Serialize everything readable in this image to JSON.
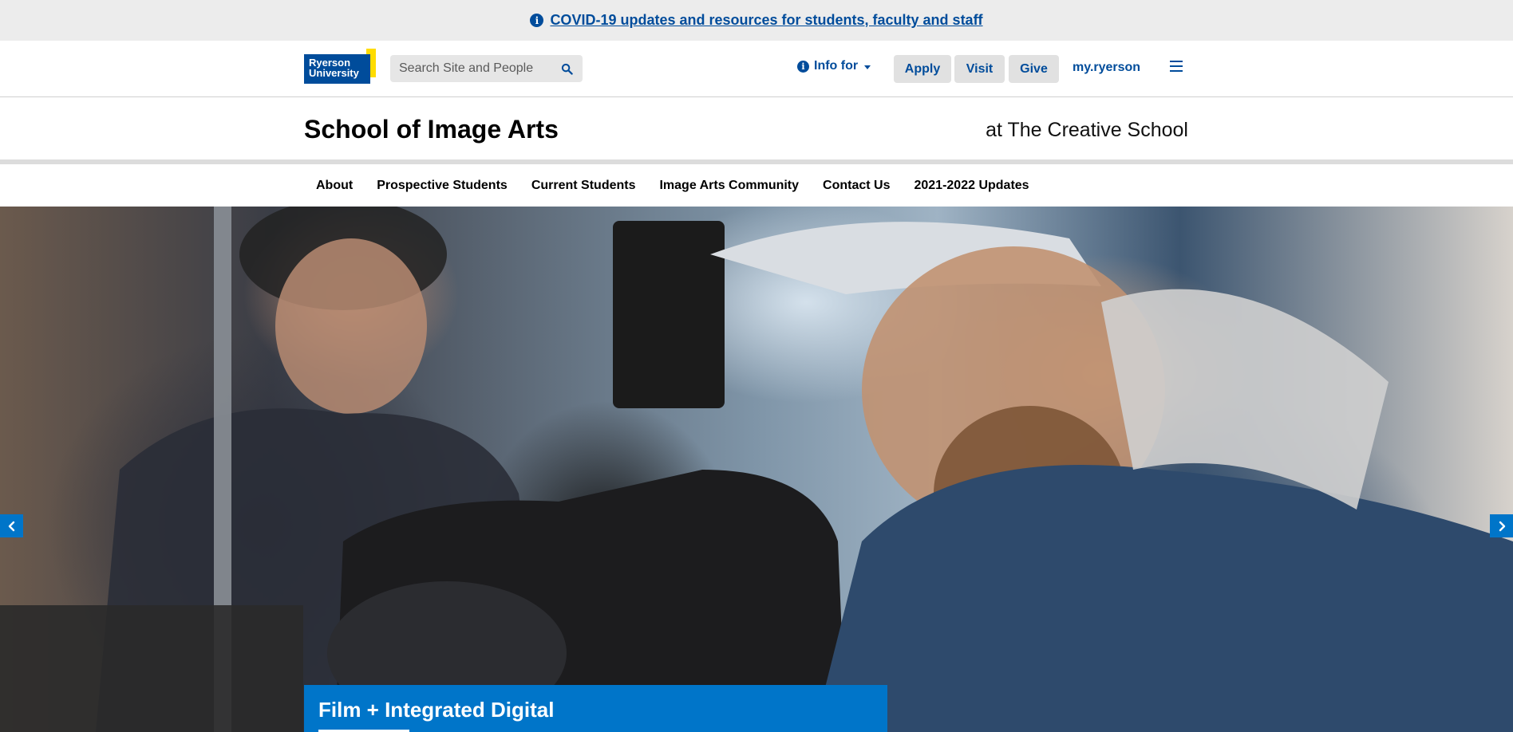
{
  "alert": {
    "icon": "info-icon",
    "text": "COVID-19 updates and resources for students, faculty and staff"
  },
  "header": {
    "logo_line1": "Ryerson",
    "logo_line2": "University",
    "search_placeholder": "Search Site and People",
    "info_for": "Info for",
    "buttons": [
      "Apply",
      "Visit",
      "Give"
    ],
    "myryerson": "my.ryerson",
    "colors": {
      "brand_blue": "#004c9b",
      "brand_yellow": "#ffdc00",
      "accent_blue": "#0075c9"
    }
  },
  "title_band": {
    "title": "School of Image Arts",
    "subtitle": "at The Creative School"
  },
  "nav": {
    "items": [
      "About",
      "Prospective Students",
      "Current Students",
      "Image Arts Community",
      "Contact Us",
      "2021-2022 Updates"
    ]
  },
  "hero": {
    "caption": "Film + Integrated Digital",
    "prev_icon": "chevron-left-icon",
    "next_icon": "chevron-right-icon"
  }
}
